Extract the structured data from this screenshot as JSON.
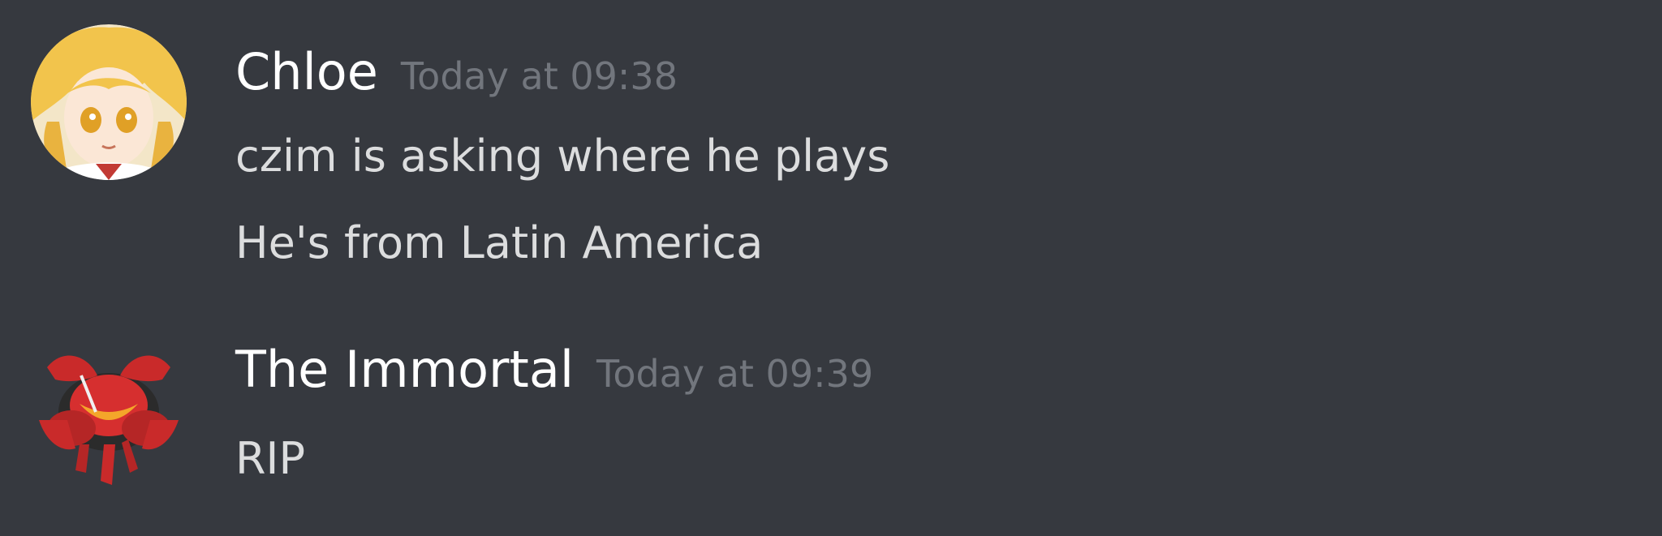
{
  "messages": [
    {
      "username": "Chloe",
      "timestamp": "Today at 09:38",
      "avatar_icon": "anime-girl-avatar",
      "lines": [
        "czim is asking where he plays",
        "He's from Latin America"
      ]
    },
    {
      "username": "The Immortal",
      "timestamp": "Today at 09:39",
      "avatar_icon": "red-creature-avatar",
      "lines": [
        "RIP"
      ]
    }
  ],
  "colors": {
    "background": "#36393f",
    "username": "#ffffff",
    "timestamp": "#72767d",
    "message_text": "#dcddde"
  }
}
